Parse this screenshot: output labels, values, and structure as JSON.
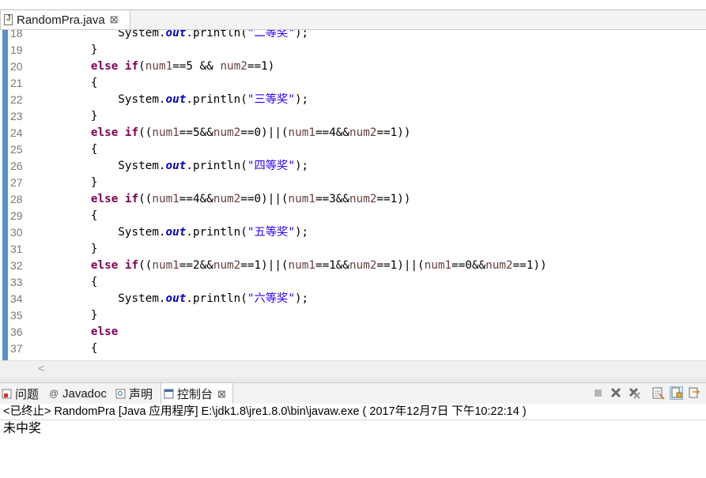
{
  "editor_tab": {
    "title": "RandomPra.java",
    "close": "⊠"
  },
  "code": {
    "lines": [
      {
        "n": "18",
        "t": "            System.out.println(\"二等奖\");"
      },
      {
        "n": "19",
        "t": "        }"
      },
      {
        "n": "20",
        "t": "        else if(num1==5 && num2==1)"
      },
      {
        "n": "21",
        "t": "        {"
      },
      {
        "n": "22",
        "t": "            System.out.println(\"三等奖\");"
      },
      {
        "n": "23",
        "t": "        }"
      },
      {
        "n": "24",
        "t": "        else if((num1==5&&num2==0)||(num1==4&&num2==1))"
      },
      {
        "n": "25",
        "t": "        {"
      },
      {
        "n": "26",
        "t": "            System.out.println(\"四等奖\");"
      },
      {
        "n": "27",
        "t": "        }"
      },
      {
        "n": "28",
        "t": "        else if((num1==4&&num2==0)||(num1==3&&num2==1))"
      },
      {
        "n": "29",
        "t": "        {"
      },
      {
        "n": "30",
        "t": "            System.out.println(\"五等奖\");"
      },
      {
        "n": "31",
        "t": "        }"
      },
      {
        "n": "32",
        "t": "        else if((num1==2&&num2==1)||(num1==1&&num2==1)||(num1==0&&num2==1))"
      },
      {
        "n": "33",
        "t": "        {"
      },
      {
        "n": "34",
        "t": "            System.out.println(\"六等奖\");"
      },
      {
        "n": "35",
        "t": "        }"
      },
      {
        "n": "36",
        "t": "        else"
      },
      {
        "n": "37",
        "t": "        {"
      }
    ]
  },
  "console_tabs": [
    {
      "label": "问题"
    },
    {
      "label": "Javadoc"
    },
    {
      "label": "声明"
    },
    {
      "label": "控制台",
      "close": "⊠"
    }
  ],
  "console": {
    "header": "<已终止> RandomPra [Java 应用程序] E:\\jdk1.8\\jre1.8.0\\bin\\javaw.exe ( 2017年12月7日 下午10:22:14 )",
    "output": "未中奖"
  },
  "colors": {
    "keyword": "#7f0055",
    "field": "#0000c0",
    "string": "#2a00ff",
    "variable": "#6a3e3e",
    "gutter": "#5b8fc7"
  }
}
